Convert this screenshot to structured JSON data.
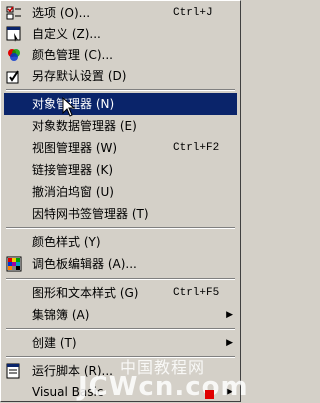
{
  "menu": {
    "items": [
      {
        "label": "选项 (O)...",
        "accel": "Ctrl+J",
        "icon": "checklist-icon"
      },
      {
        "label": "自定义 (Z)...",
        "icon": "customize-icon"
      },
      {
        "label": "颜色管理 (C)...",
        "icon": "color-wheel-icon"
      },
      {
        "label": "另存默认设置 (D)",
        "icon": "save-defaults-icon"
      },
      {
        "label": "对象管理器 (N)",
        "highlighted": true
      },
      {
        "label": "对象数据管理器 (E)"
      },
      {
        "label": "视图管理器 (W)",
        "accel": "Ctrl+F2"
      },
      {
        "label": "链接管理器 (K)"
      },
      {
        "label": "撤消泊坞窗 (U)"
      },
      {
        "label": "因特网书签管理器 (T)"
      },
      {
        "label": "颜色样式 (Y)"
      },
      {
        "label": "调色板编辑器 (A)...",
        "icon": "palette-editor-icon"
      },
      {
        "label": "图形和文本样式 (G)",
        "accel": "Ctrl+F5"
      },
      {
        "label": "集锦簿 (A)",
        "submenu": true
      },
      {
        "label": "创建 (T)",
        "submenu": true
      },
      {
        "label": "运行脚本 (R)...",
        "icon": "script-icon"
      },
      {
        "label": "Visual Basic",
        "submenu": true
      }
    ]
  },
  "watermark": {
    "line1": "中国教程网",
    "line2": "JCWcn.com"
  }
}
